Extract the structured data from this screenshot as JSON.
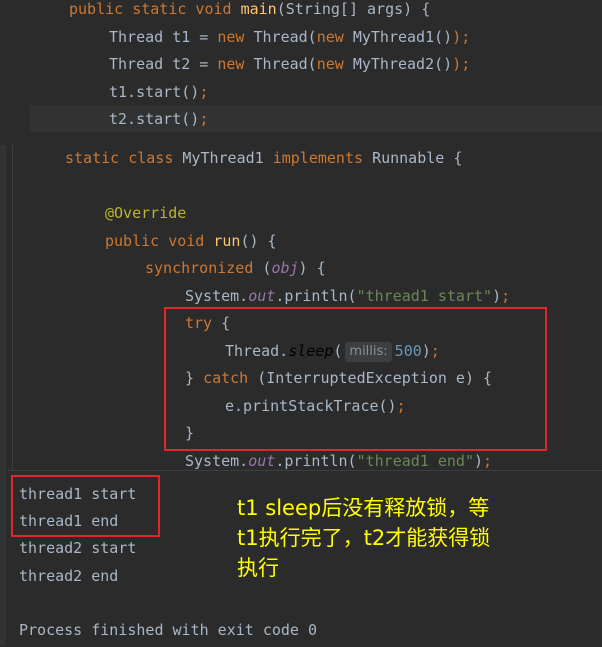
{
  "top_editor": {
    "lines": [
      {
        "parts": [
          [
            "kw",
            "public static void "
          ],
          [
            "fn",
            "main"
          ],
          [
            "pl",
            "(String[] args) {"
          ]
        ]
      },
      {
        "parts": [
          [
            "pl",
            "Thread t1 = "
          ],
          [
            "kw",
            "new "
          ],
          [
            "pl",
            "Thread("
          ],
          [
            "kw",
            "new "
          ],
          [
            "pl",
            "MyThread1()"
          ],
          [
            "kw",
            ");"
          ]
        ]
      },
      {
        "parts": [
          [
            "pl",
            "Thread t2 = "
          ],
          [
            "kw",
            "new "
          ],
          [
            "pl",
            "Thread("
          ],
          [
            "kw",
            "new "
          ],
          [
            "pl",
            "MyThread2()"
          ],
          [
            "kw",
            ");"
          ]
        ]
      },
      {
        "parts": [
          [
            "pl",
            "t1.start()"
          ],
          [
            "kw",
            ";"
          ]
        ]
      },
      {
        "parts": [
          [
            "pl",
            "t2.start()"
          ],
          [
            "kw",
            ";"
          ]
        ]
      }
    ]
  },
  "bottom_editor": {
    "lines": [
      {
        "parts": [
          [
            "kw",
            "static class "
          ],
          [
            "pl",
            "MyThread1 "
          ],
          [
            "kw",
            "implements "
          ],
          [
            "pl",
            "Runnable {"
          ]
        ]
      },
      {
        "parts": []
      },
      {
        "parts": [
          [
            "anno",
            "@Override"
          ]
        ]
      },
      {
        "parts": [
          [
            "kw",
            "public void "
          ],
          [
            "fn",
            "run"
          ],
          [
            "pl",
            "() {"
          ]
        ]
      },
      {
        "parts": [
          [
            "kw",
            "synchronized "
          ],
          [
            "pl",
            "("
          ],
          [
            "field",
            "obj"
          ],
          [
            "pl",
            ") {"
          ]
        ]
      },
      {
        "parts": [
          [
            "pl",
            "System."
          ],
          [
            "field",
            "out"
          ],
          [
            "pl",
            ".println("
          ],
          [
            "str",
            "\"thread1 start\""
          ],
          [
            "pl",
            ")"
          ],
          [
            "kw",
            ";"
          ]
        ]
      },
      {
        "parts": [
          [
            "kw",
            "try "
          ],
          [
            "pl",
            "{"
          ]
        ]
      },
      {
        "parts": [
          [
            "pl",
            "Thread."
          ],
          [
            "it",
            "sleep"
          ],
          [
            "pl",
            "("
          ],
          [
            "hint",
            "millis:"
          ],
          [
            "num",
            "500"
          ],
          [
            "pl",
            ")"
          ],
          [
            "kw",
            ";"
          ]
        ]
      },
      {
        "parts": [
          [
            "pl",
            "} "
          ],
          [
            "kw",
            "catch "
          ],
          [
            "pl",
            "(InterruptedException e) {"
          ]
        ]
      },
      {
        "parts": [
          [
            "pl",
            "e.printStackTrace()"
          ],
          [
            "kw",
            ";"
          ]
        ]
      },
      {
        "parts": [
          [
            "pl",
            "}"
          ]
        ]
      },
      {
        "parts": [
          [
            "pl",
            "System."
          ],
          [
            "field",
            "out"
          ],
          [
            "pl",
            ".println("
          ],
          [
            "str",
            "\"thread1 end\""
          ],
          [
            "pl",
            ")"
          ],
          [
            "kw",
            ";"
          ]
        ]
      }
    ]
  },
  "console": {
    "lines": [
      "thread1 start",
      "thread1 end",
      "thread2 start",
      "thread2 end",
      "",
      "Process finished with exit code 0"
    ]
  },
  "annotation": {
    "text": "t1 sleep后没有释放锁，等\nt1执行完了，t2才能获得锁\n执行"
  },
  "colors": {
    "editor_bg": "#2b2b2b",
    "console_bg": "#2b2b2b",
    "highlight_box": "#e0252b",
    "annotation_text": "#ffff00",
    "current_line": "#323232"
  }
}
